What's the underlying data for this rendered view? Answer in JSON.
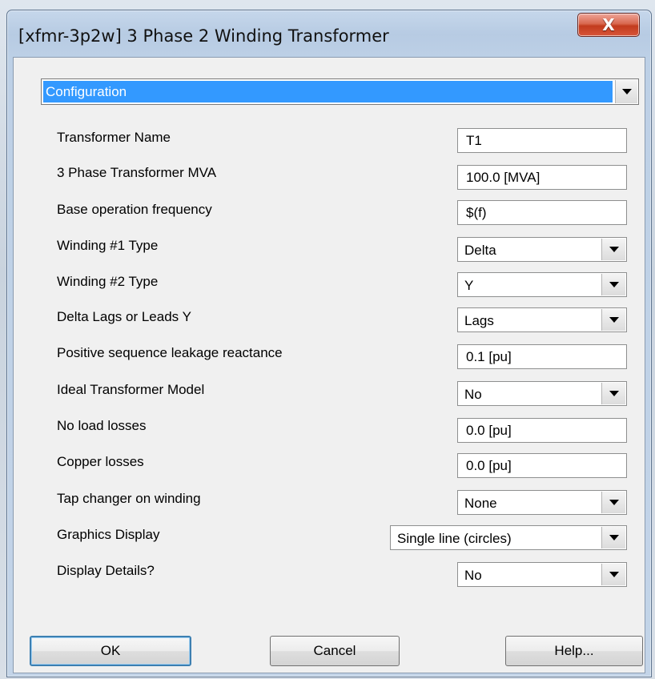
{
  "window": {
    "title": "[xfmr-3p2w] 3 Phase 2 Winding Transformer",
    "close_label": "X"
  },
  "category": {
    "selected": "Configuration"
  },
  "params": [
    {
      "label": "Transformer Name",
      "type": "text",
      "value": "T1"
    },
    {
      "label": "3 Phase Transformer MVA",
      "type": "text",
      "value": "100.0 [MVA]"
    },
    {
      "label": "Base operation frequency",
      "type": "text",
      "value": "$(f)"
    },
    {
      "label": "Winding #1 Type",
      "type": "select",
      "value": "Delta"
    },
    {
      "label": "Winding #2 Type",
      "type": "select",
      "value": "Y"
    },
    {
      "label": "Delta Lags or Leads Y",
      "type": "select",
      "value": "Lags"
    },
    {
      "label": "Positive sequence leakage reactance",
      "type": "text",
      "value": "0.1 [pu]"
    },
    {
      "label": "Ideal Transformer Model",
      "type": "select",
      "value": "No"
    },
    {
      "label": "No load losses",
      "type": "text",
      "value": "0.0 [pu]"
    },
    {
      "label": "Copper losses",
      "type": "text",
      "value": "0.0 [pu]"
    },
    {
      "label": "Tap changer on winding",
      "type": "select",
      "value": "None"
    },
    {
      "label": "Graphics Display",
      "type": "select",
      "value": "Single line (circles)"
    },
    {
      "label": "Display Details?",
      "type": "select",
      "value": "No"
    }
  ],
  "buttons": {
    "ok": "OK",
    "cancel": "Cancel",
    "help": "Help..."
  },
  "colors": {
    "selection": "#3399ff",
    "close_button": "#c23b1d",
    "dialog_face": "#f0f0f0"
  }
}
